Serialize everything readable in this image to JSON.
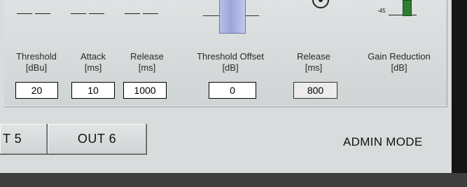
{
  "controls": [
    {
      "label": "Threshold",
      "unit": "[dBu]",
      "value": "20"
    },
    {
      "label": "Attack",
      "unit": "[ms]",
      "value": "10"
    },
    {
      "label": "Release",
      "unit": "[ms]",
      "value": "1000"
    },
    {
      "label": "Threshold Offset",
      "unit": "[dB]",
      "value": "0"
    },
    {
      "label": "Release",
      "unit": "[ms]",
      "value": "800"
    },
    {
      "label": "Gain Reduction",
      "unit": "[dB]"
    }
  ],
  "gain_scale_label": "-45",
  "tabs": [
    {
      "label": "T 5"
    },
    {
      "label": "OUT 6"
    }
  ],
  "mode_label": "ADMIN MODE"
}
